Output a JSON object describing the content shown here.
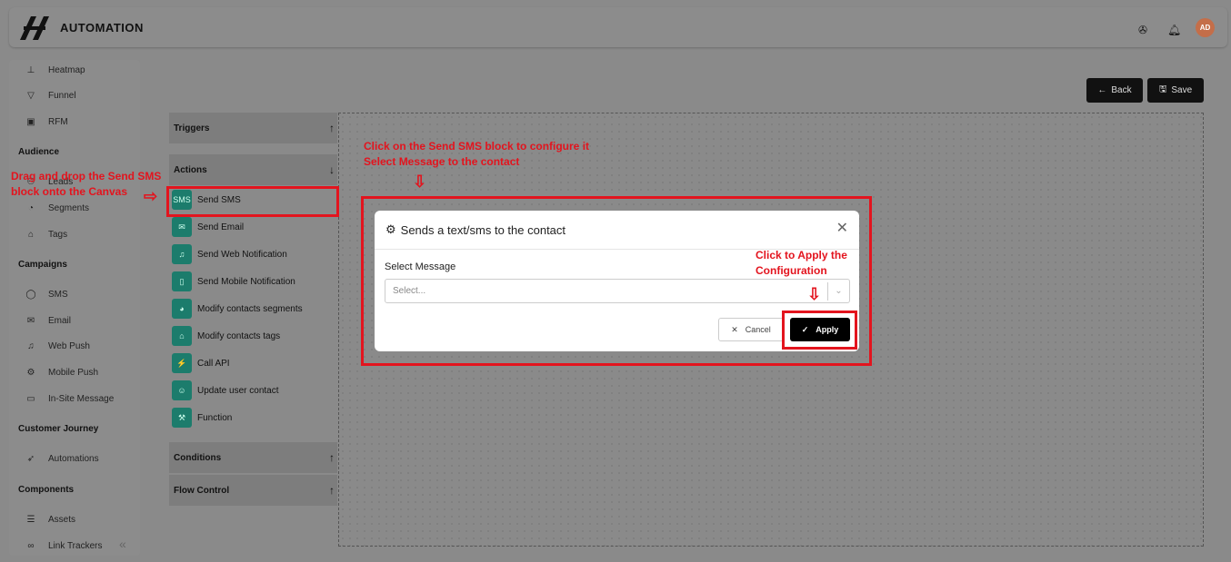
{
  "header": {
    "title": "AUTOMATION",
    "avatar_initials": "AD",
    "icons": [
      "help-icon",
      "bell-icon"
    ]
  },
  "sidebar": {
    "items_top": [
      {
        "label": "Heatmap",
        "icon": "heatmap-icon"
      },
      {
        "label": "Funnel",
        "icon": "funnel-icon"
      },
      {
        "label": "RFM",
        "icon": "rfm-icon"
      }
    ],
    "audience": {
      "heading": "Audience",
      "items": [
        {
          "label": "Leads"
        },
        {
          "label": "Segments"
        },
        {
          "label": "Tags"
        }
      ]
    },
    "campaigns": {
      "heading": "Campaigns",
      "items": [
        {
          "label": "SMS"
        },
        {
          "label": "Email"
        },
        {
          "label": "Web Push"
        },
        {
          "label": "Mobile Push"
        },
        {
          "label": "In-Site Message"
        }
      ]
    },
    "journey": {
      "heading": "Customer Journey",
      "items": [
        {
          "label": "Automations"
        }
      ]
    },
    "components": {
      "heading": "Components",
      "items": [
        {
          "label": "Assets"
        },
        {
          "label": "Link Trackers"
        }
      ]
    }
  },
  "toolbar": {
    "back_label": "Back",
    "save_label": "Save"
  },
  "panel": {
    "triggers": "Triggers",
    "actions": "Actions",
    "action_items": [
      "Send SMS",
      "Send Email",
      "Send Web Notification",
      "Send Mobile Notification",
      "Modify contacts segments",
      "Modify contacts tags",
      "Call API",
      "Update user contact",
      "Function"
    ],
    "conditions": "Conditions",
    "flow_control": "Flow Control"
  },
  "modal": {
    "title": "Sends a text/sms to the contact",
    "field_label": "Select Message",
    "select_placeholder": "Select...",
    "cancel_label": "Cancel",
    "apply_label": "Apply"
  },
  "annotations": {
    "drag_line1": "Drag and drop the Send SMS",
    "drag_line2": "block onto the Canvas",
    "click_line1": "Click on the Send SMS block to configure it",
    "click_line2": "Select Message to the contact",
    "apply_line1": "Click to Apply the",
    "apply_line2": "Configuration"
  },
  "colors": {
    "highlight": "#e3141e",
    "action_icon": "#1c7c6c",
    "primary_button": "#000000"
  }
}
